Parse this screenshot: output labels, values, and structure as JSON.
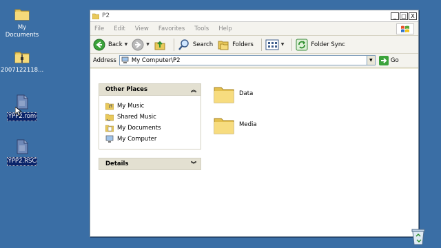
{
  "desktop": {
    "icons": [
      {
        "label": "My Documents",
        "icon": "folder-icon"
      },
      {
        "label": "2007122118...",
        "icon": "zip-folder-icon"
      },
      {
        "label": "YPP2.rom",
        "icon": "file-icon"
      },
      {
        "label": "YPP2.RSC",
        "icon": "file-icon"
      }
    ]
  },
  "window": {
    "title": "P2",
    "buttons": {
      "minimize": "_",
      "maximize": "□",
      "close": "X"
    },
    "menu": [
      "File",
      "Edit",
      "View",
      "Favorites",
      "Tools",
      "Help"
    ],
    "toolbar": {
      "back": "Back",
      "search": "Search",
      "folders": "Folders",
      "folder_sync": "Folder Sync"
    },
    "address": {
      "label": "Address",
      "value": "My Computer\\P2",
      "go": "Go"
    },
    "taskpane": {
      "other_places": {
        "title": "Other Places",
        "links": [
          {
            "label": "My Music",
            "icon": "music-folder-icon"
          },
          {
            "label": "Shared Music",
            "icon": "shared-music-icon"
          },
          {
            "label": "My Documents",
            "icon": "my-documents-icon"
          },
          {
            "label": "My Computer",
            "icon": "computer-icon"
          }
        ]
      },
      "details": {
        "title": "Details"
      }
    },
    "files": [
      {
        "name": "Data"
      },
      {
        "name": "Media"
      }
    ]
  },
  "colors": {
    "desktop": "#3a6ea5",
    "selection": "#0a246a",
    "window_chrome": "#ece9d8"
  }
}
